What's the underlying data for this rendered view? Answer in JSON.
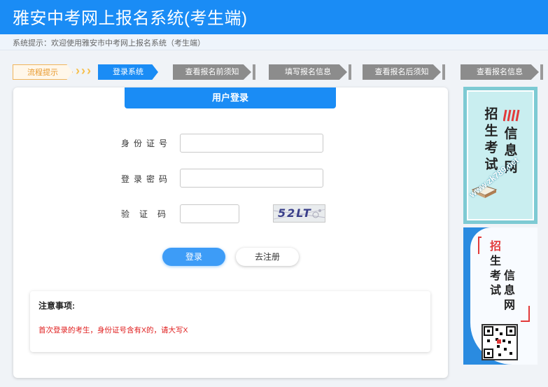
{
  "header": {
    "title": "雅安中考网上报名系统(考生端)"
  },
  "notice": {
    "text": "系统提示：欢迎使用雅安市中考网上报名系统（考生端）"
  },
  "steps": [
    {
      "label": "流程提示"
    },
    {
      "label": "登录系统"
    },
    {
      "label": "查看报名前须知"
    },
    {
      "label": "填写报名信息"
    },
    {
      "label": "查看报名后须知"
    },
    {
      "label": "查看报名信息"
    }
  ],
  "login": {
    "tab_label": "用户登录",
    "id_label": "身份证号",
    "password_label": "登录密码",
    "captcha_label": "验证码",
    "id_value": "",
    "password_value": "",
    "captcha_value": "",
    "captcha_text": "52LT",
    "login_button": "登录",
    "register_button": "去注册"
  },
  "notes": {
    "title": "注意事项:",
    "text": "首次登录的考生，身份证号含有X的，请大写X"
  },
  "ads": {
    "ad1_chars_left": [
      "招",
      "生",
      "考",
      "试"
    ],
    "ad1_chars_right": [
      "信",
      "息",
      "网"
    ],
    "ad1_url": "www.zk789.net",
    "ad2_chars_left": [
      "招",
      "生",
      "考",
      "试"
    ],
    "ad2_chars_right": [
      "信",
      "息",
      "网"
    ]
  },
  "colors": {
    "primary": "#1a8cf5",
    "warning": "#e02020",
    "step_gray": "#8c8c8c"
  }
}
